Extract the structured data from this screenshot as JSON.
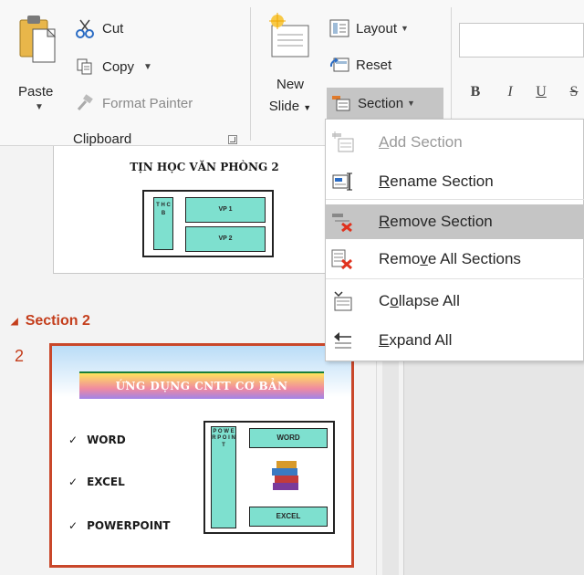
{
  "ribbon": {
    "clipboard": {
      "paste_label": "Paste",
      "cut_label": "Cut",
      "copy_label": "Copy",
      "format_painter_label": "Format Painter",
      "group_label": "Clipboard"
    },
    "slides": {
      "new_slide_line1": "New",
      "new_slide_line2": "Slide",
      "layout_label": "Layout",
      "reset_label": "Reset",
      "section_label": "Section"
    },
    "font": {
      "bold": "B",
      "italic": "I",
      "underline": "U",
      "strikethrough": "S"
    }
  },
  "section_menu": {
    "items": [
      {
        "label_pre": "",
        "label_ul": "A",
        "label_post": "dd Section",
        "enabled": false,
        "highlighted": false,
        "icon": "add-section-icon"
      },
      {
        "label_pre": "",
        "label_ul": "R",
        "label_post": "ename Section",
        "enabled": true,
        "highlighted": false,
        "icon": "rename-section-icon"
      },
      {
        "label_pre": "",
        "label_ul": "R",
        "label_post": "emove Section",
        "enabled": true,
        "highlighted": true,
        "icon": "remove-section-icon"
      },
      {
        "label_pre": "Remo",
        "label_ul": "v",
        "label_post": "e All Sections",
        "enabled": true,
        "highlighted": false,
        "icon": "remove-all-sections-icon"
      },
      {
        "label_pre": "C",
        "label_ul": "o",
        "label_post": "llapse All",
        "enabled": true,
        "highlighted": false,
        "icon": "collapse-all-icon"
      },
      {
        "label_pre": "",
        "label_ul": "E",
        "label_post": "xpand All",
        "enabled": true,
        "highlighted": false,
        "icon": "expand-all-icon"
      }
    ]
  },
  "slide_pane": {
    "slide1": {
      "title": "TỊN HỌC VĂN PHÒNG 2",
      "col_text": "T H C B",
      "box1": "VP 1",
      "box2": "VP 2"
    },
    "section2": {
      "label": "Section 2"
    },
    "slide2": {
      "number": "2",
      "title": "ỨNG DỤNG CNTT CƠ BẢN",
      "items": [
        "WORD",
        "EXCEL",
        "POWERPOINT"
      ],
      "col_text": "P O W E R P O I N T",
      "box1": "WORD",
      "box2": "EXCEL"
    }
  },
  "colors": {
    "accent_red": "#c43e1c",
    "slide_border": "#c9472a",
    "highlight": "#c5c5c5",
    "teal_box": "#7ee0cf"
  }
}
